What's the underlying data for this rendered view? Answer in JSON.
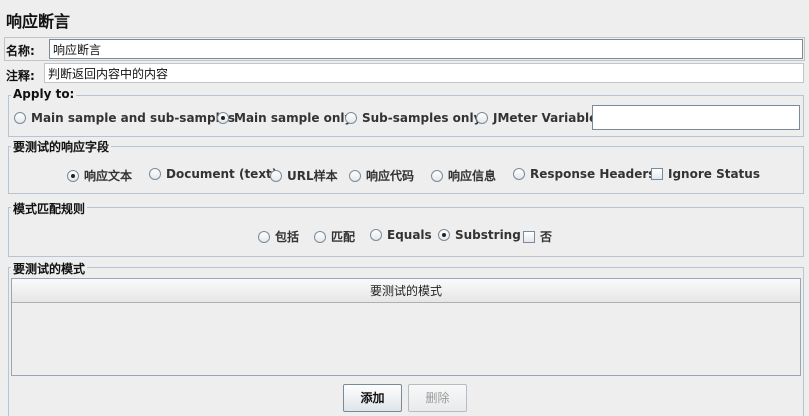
{
  "panel": {
    "title": "响应断言",
    "name_label": "名称:",
    "name_value": "响应断言",
    "comment_label": "注释:",
    "comment_value": "判断返回内容中的内容"
  },
  "apply_to": {
    "legend": "Apply to:",
    "options": [
      {
        "label": "Main sample and sub-samples",
        "selected": false
      },
      {
        "label": "Main sample only",
        "selected": true
      },
      {
        "label": "Sub-samples only",
        "selected": false
      },
      {
        "label": "JMeter Variable",
        "selected": false
      }
    ],
    "variable_value": ""
  },
  "field_to_test": {
    "legend": "要测试的响应字段",
    "options": [
      {
        "label": "响应文本",
        "selected": true
      },
      {
        "label": "Document (text)",
        "selected": false
      },
      {
        "label": "URL样本",
        "selected": false
      },
      {
        "label": "响应代码",
        "selected": false
      },
      {
        "label": "响应信息",
        "selected": false
      },
      {
        "label": "Response Headers",
        "selected": false
      }
    ],
    "ignore_status_label": "Ignore Status",
    "ignore_status_checked": false
  },
  "pattern_rules": {
    "legend": "模式匹配规则",
    "options": [
      {
        "label": "包括",
        "selected": false
      },
      {
        "label": "匹配",
        "selected": false
      },
      {
        "label": "Equals",
        "selected": false
      },
      {
        "label": "Substring",
        "selected": true
      }
    ],
    "not_label": "否",
    "not_checked": false
  },
  "patterns": {
    "legend": "要测试的模式",
    "column_header": "要测试的模式",
    "rows": []
  },
  "buttons": {
    "add_label": "添加",
    "delete_label": "删除"
  }
}
